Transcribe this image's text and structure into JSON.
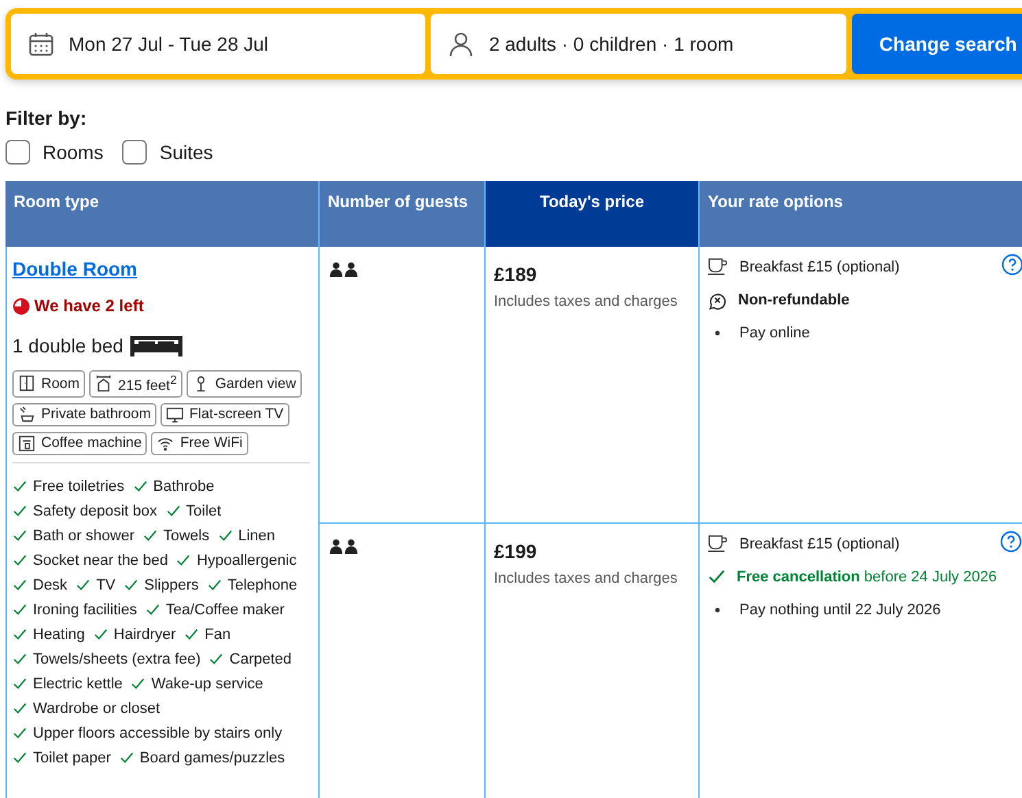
{
  "search": {
    "dates": "Mon 27 Jul - Tue 28 Jul",
    "guests": "2 adults · 0 children · 1 room",
    "button": "Change search"
  },
  "filter": {
    "label": "Filter by:",
    "options": [
      {
        "label": "Rooms",
        "checked": false
      },
      {
        "label": "Suites",
        "checked": false
      }
    ]
  },
  "table": {
    "columns": [
      {
        "label": "Room type",
        "highlighted": false
      },
      {
        "label": "Number of guests",
        "highlighted": false
      },
      {
        "label": "Today's price",
        "highlighted": true
      },
      {
        "label": "Your rate options",
        "highlighted": false
      }
    ],
    "room": {
      "name": "Double Room",
      "availability": "We have 2 left",
      "bed": "1 double bed",
      "features": [
        [
          "Room",
          "215 feet$^{2}$",
          "Garden view"
        ],
        [
          "Private bathroom",
          "Flat-screen TV"
        ],
        [
          "Coffee machine",
          "Free WiFi"
        ]
      ],
      "facilities": [
        [
          "Free toiletries",
          "Bathrobe"
        ],
        [
          "Safety deposit box",
          "Toilet"
        ],
        [
          "Bath or shower",
          "Towels",
          "Linen"
        ],
        [
          "Socket near the bed",
          "Hypoallergenic"
        ],
        [
          "Desk",
          "TV",
          "Slippers",
          "Telephone"
        ],
        [
          "Ironing facilities",
          "Tea/Coffee maker"
        ],
        [
          "Heating",
          "Hairdryer",
          "Fan"
        ],
        [
          "Towels/sheets (extra fee)",
          "Carpeted"
        ],
        [
          "Electric kettle",
          "Wake-up service"
        ],
        [
          "Wardrobe or closet"
        ],
        [
          "Upper floors accessible by stairs only"
        ],
        [
          "Toilet paper",
          "Board games/puzzles"
        ]
      ]
    },
    "rates": [
      {
        "price": "£189",
        "price_note": "Includes taxes and charges",
        "options": [
          {
            "kind": "meal",
            "text": "Breakfast £15 (optional)"
          },
          {
            "kind": "nonrefundable",
            "text": "Non-refundable"
          },
          {
            "kind": "bullet",
            "text": "Pay online"
          }
        ]
      },
      {
        "price": "£199",
        "price_note": "Includes taxes and charges",
        "options": [
          {
            "kind": "meal",
            "text": "Breakfast £15 (optional)"
          },
          {
            "kind": "free-cancel",
            "text": "**Free cancellation** before 24 July 2026"
          },
          {
            "kind": "bullet",
            "text": "Pay nothing until 22 July 2026"
          }
        ]
      }
    ]
  }
}
